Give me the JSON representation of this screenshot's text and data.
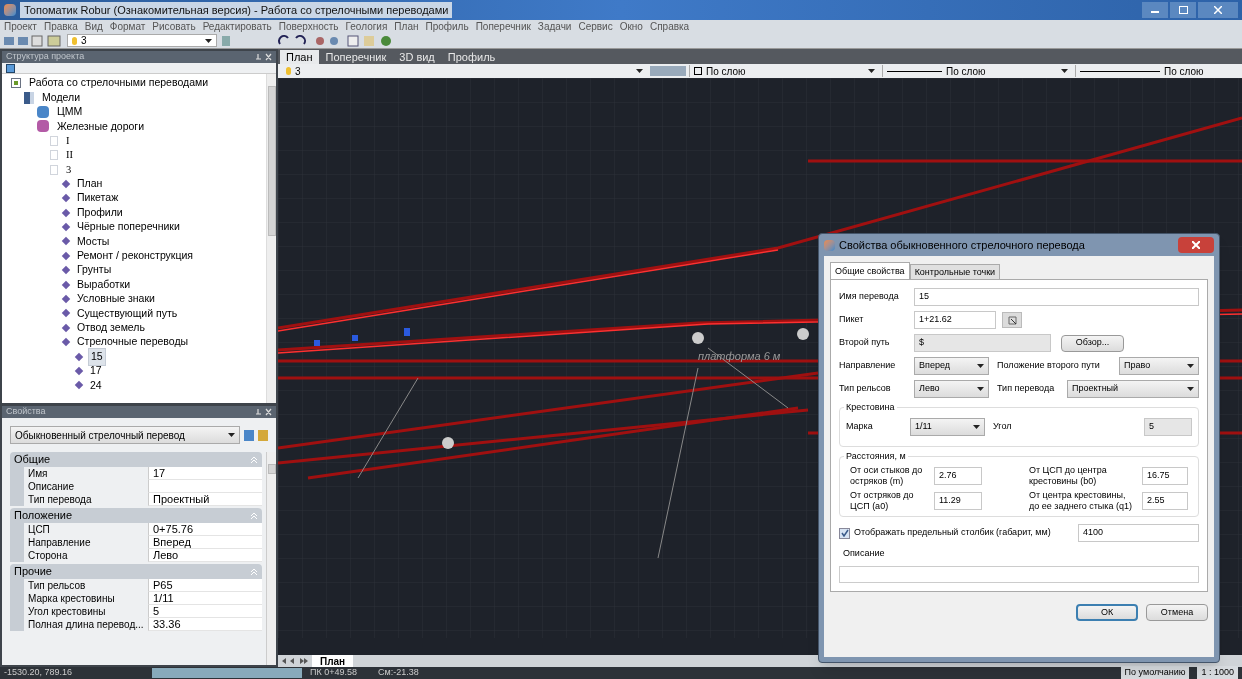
{
  "window": {
    "title": "Топоматик Robur (Ознакомительная версия) - Работа со стрелочными переводами"
  },
  "menu": [
    "Проект",
    "Правка",
    "Вид",
    "Формат",
    "Рисовать",
    "Редактировать",
    "Поверхность",
    "Геология",
    "План",
    "Профиль",
    "Поперечник",
    "Задачи",
    "Сервис",
    "Окно",
    "Справка"
  ],
  "toolbar": {
    "layer": "3"
  },
  "project_panel": {
    "title": "Структура проекта",
    "tree": [
      {
        "label": "Работа со стрелочными переводами",
        "kind": "project",
        "selected": false,
        "children": [
          {
            "label": "Модели",
            "kind": "models",
            "selected": false,
            "children": [
              {
                "label": "ЦММ",
                "kind": "dtm",
                "selected": false
              },
              {
                "label": "Железные дороги",
                "kind": "railways",
                "selected": false,
                "children": [
                  {
                    "label": "I",
                    "kind": "track",
                    "selected": false
                  },
                  {
                    "label": "II",
                    "kind": "track",
                    "selected": false
                  },
                  {
                    "label": "3",
                    "kind": "track",
                    "selected": false,
                    "children": [
                      {
                        "label": "План",
                        "kind": "layer",
                        "selected": false
                      },
                      {
                        "label": "Пикетаж",
                        "kind": "layer",
                        "selected": false
                      },
                      {
                        "label": "Профили",
                        "kind": "layer",
                        "selected": false
                      },
                      {
                        "label": "Чёрные поперечники",
                        "kind": "layer",
                        "selected": false
                      },
                      {
                        "label": "Мосты",
                        "kind": "layer",
                        "selected": false
                      },
                      {
                        "label": "Ремонт / реконструкция",
                        "kind": "layer",
                        "selected": false
                      },
                      {
                        "label": "Грунты",
                        "kind": "layer",
                        "selected": false
                      },
                      {
                        "label": "Выработки",
                        "kind": "layer",
                        "selected": false
                      },
                      {
                        "label": "Условные знаки",
                        "kind": "layer",
                        "selected": false
                      },
                      {
                        "label": "Существующий путь",
                        "kind": "layer",
                        "selected": false
                      },
                      {
                        "label": "Отвод земель",
                        "kind": "layer",
                        "selected": false
                      },
                      {
                        "label": "Стрелочные переводы",
                        "kind": "layer",
                        "selected": false,
                        "children": [
                          {
                            "label": "15",
                            "kind": "layer",
                            "selected": true
                          },
                          {
                            "label": "17",
                            "kind": "layer",
                            "selected": false
                          },
                          {
                            "label": "24",
                            "kind": "layer",
                            "selected": false
                          }
                        ]
                      }
                    ]
                  }
                ]
              }
            ]
          }
        ]
      }
    ]
  },
  "properties_panel": {
    "title": "Свойства",
    "object_type": "Обыкновенный стрелочный перевод",
    "groups": [
      {
        "title": "Общие",
        "rows": [
          {
            "label": "Имя",
            "value": "17"
          },
          {
            "label": "Описание",
            "value": ""
          },
          {
            "label": "Тип перевода",
            "value": "Проектный"
          }
        ]
      },
      {
        "title": "Положение",
        "rows": [
          {
            "label": "ЦСП",
            "value": "0+75.76"
          },
          {
            "label": "Направление",
            "value": "Вперед"
          },
          {
            "label": "Сторона",
            "value": "Лево"
          }
        ]
      },
      {
        "title": "Прочие",
        "rows": [
          {
            "label": "Тип рельсов",
            "value": "Р65"
          },
          {
            "label": "Марка крестовины",
            "value": "1/11"
          },
          {
            "label": "Угол крестовины",
            "value": "5"
          },
          {
            "label": "Полная длина перевод...",
            "value": "33.36"
          }
        ]
      }
    ]
  },
  "view_tabs": [
    {
      "label": "План",
      "selected": true
    },
    {
      "label": "Поперечник",
      "selected": false
    },
    {
      "label": "3D вид",
      "selected": false
    },
    {
      "label": "Профиль",
      "selected": false
    }
  ],
  "layer_bar": {
    "layer": "3",
    "swatch_setting": "По слою",
    "linetype": "По слою",
    "lineweight": "По слою"
  },
  "canvas": {
    "labels": [
      "платформа 6 м"
    ]
  },
  "sheet_tabs": [
    {
      "label": "План",
      "selected": true
    }
  ],
  "dialog": {
    "title": "Свойства обыкновенного стрелочного перевода",
    "tabs": [
      {
        "label": "Общие свойства",
        "selected": true
      },
      {
        "label": "Контрольные точки",
        "selected": false
      }
    ],
    "name": {
      "label": "Имя перевода",
      "value": "15"
    },
    "picket": {
      "label": "Пикет",
      "value": "1+21.62"
    },
    "second_track": {
      "label": "Второй путь",
      "value": "$",
      "disabled": true,
      "button": "Обзор..."
    },
    "direction": {
      "label": "Направление",
      "value": "Вперед"
    },
    "second_position": {
      "label": "Положение второго пути",
      "value": "Право"
    },
    "rail_type": {
      "label": "Тип рельсов",
      "value": "Лево"
    },
    "switch_type": {
      "label": "Тип перевода",
      "value": "Проектный"
    },
    "frog": {
      "title": "Крестовина",
      "mark_label": "Марка",
      "mark": "1/11",
      "angle_label": "Угол",
      "angle": "5",
      "angle_disabled": true
    },
    "distances": {
      "title": "Расстояния, м",
      "items": [
        {
          "label": "От оси стыков до остряков (m)",
          "value": "2.76"
        },
        {
          "label": "От ЦСП до центра крестовины (b0)",
          "value": "16.75"
        },
        {
          "label": "От остряков до ЦСП (a0)",
          "value": "11.29"
        },
        {
          "label": "От центра крестовины, до ее заднего стыка (q1)",
          "value": "2.55"
        }
      ]
    },
    "show_post": {
      "label": "Отображать предельный столбик (габарит, мм)",
      "checked": true,
      "value": "4100"
    },
    "description": {
      "label": "Описание"
    },
    "buttons": [
      {
        "label": "ОК",
        "kind": "default"
      },
      {
        "label": "Отмена",
        "kind": "normal"
      }
    ]
  },
  "status_bar": {
    "coords": "-1530.20, 789.16",
    "picket": "ПК 0+49.58",
    "offset": "См:-21.38",
    "style": "По умолчанию",
    "scale": "1 : 1000"
  }
}
